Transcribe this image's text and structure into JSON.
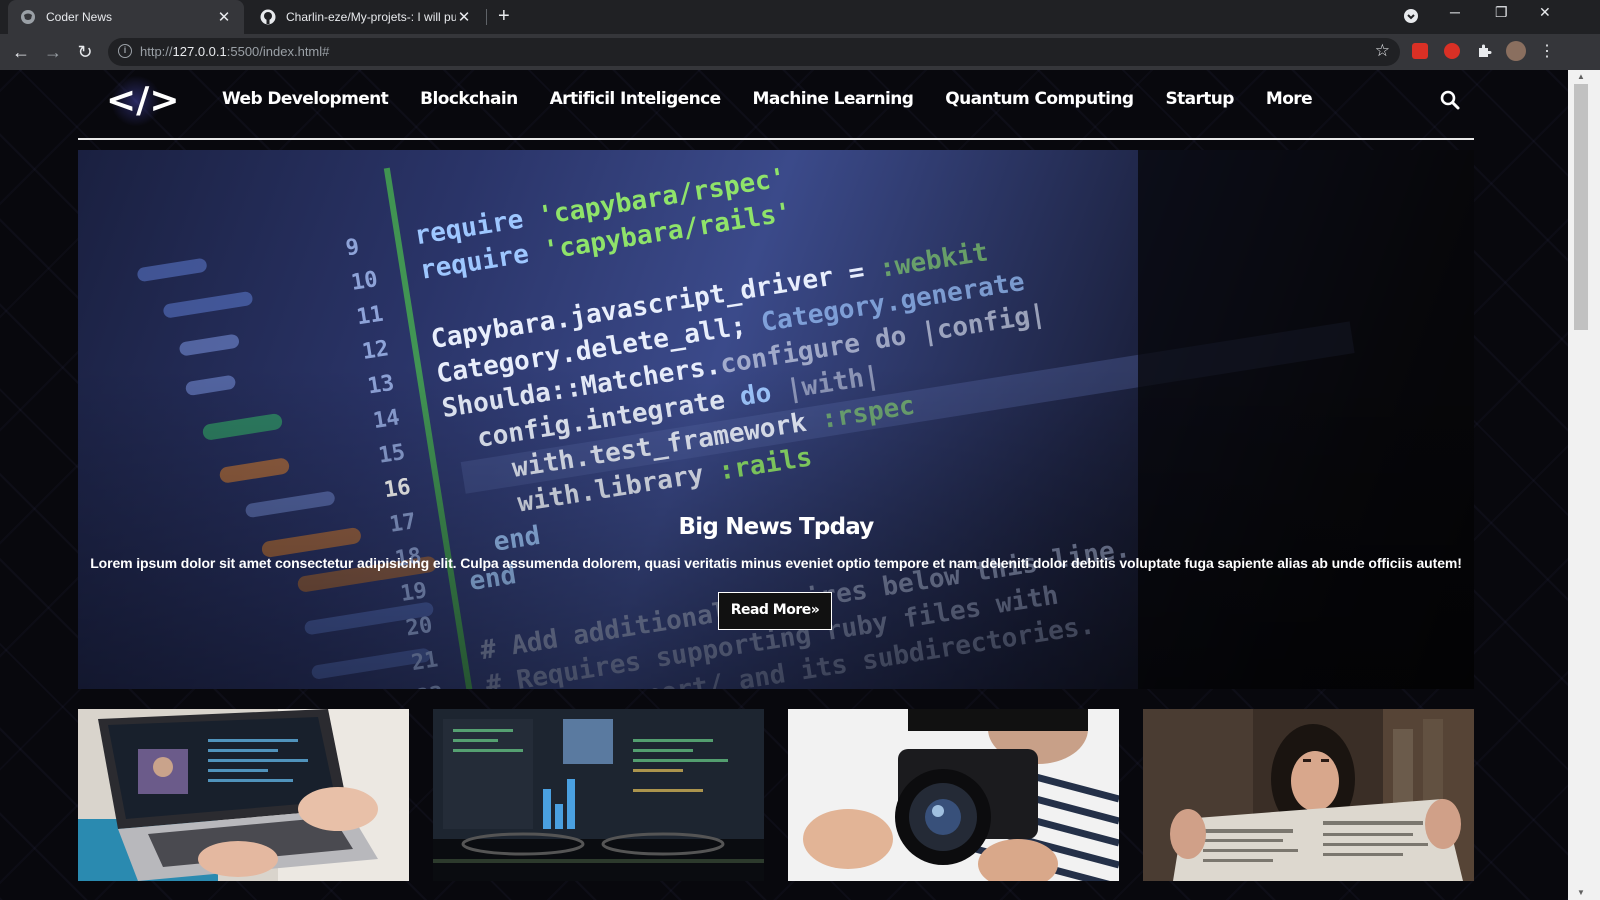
{
  "browser": {
    "tabs": [
      {
        "title": "Coder News",
        "active": true,
        "icon": "globe-icon"
      },
      {
        "title": "Charlin-eze/My-projets-: I will pu",
        "active": false,
        "icon": "github-icon"
      }
    ],
    "url_prefix": "http://",
    "url_host": "127.0.0.1",
    "url_rest": ":5500/index.html#"
  },
  "nav": {
    "logo": "</>",
    "links": [
      "Web Development",
      "Blockchain",
      "Artificil Inteligence",
      "Machine Learning",
      "Quantum Computing",
      "Startup",
      "More"
    ]
  },
  "hero": {
    "title": "Big News Tpday",
    "text": "Lorem ipsum dolor sit amet consectetur adipisicing elit. Culpa assumenda dolorem, quasi veritatis minus eveniet optio tempore et nam deleniti dolor debitis voluptate fuga sapiente alias ab unde officiis autem!",
    "button": "Read More»"
  },
  "cards": [
    {
      "image": "laptop-video-call"
    },
    {
      "image": "monitor-code-glasses"
    },
    {
      "image": "camera-operator"
    },
    {
      "image": "woman-reading-newspaper"
    }
  ],
  "colors": {
    "page_bg": "#08080d",
    "chrome_dark": "#202124",
    "chrome_toolbar": "#35363a",
    "code_green": "#8fe36a",
    "code_blue": "#9ec7ff"
  }
}
